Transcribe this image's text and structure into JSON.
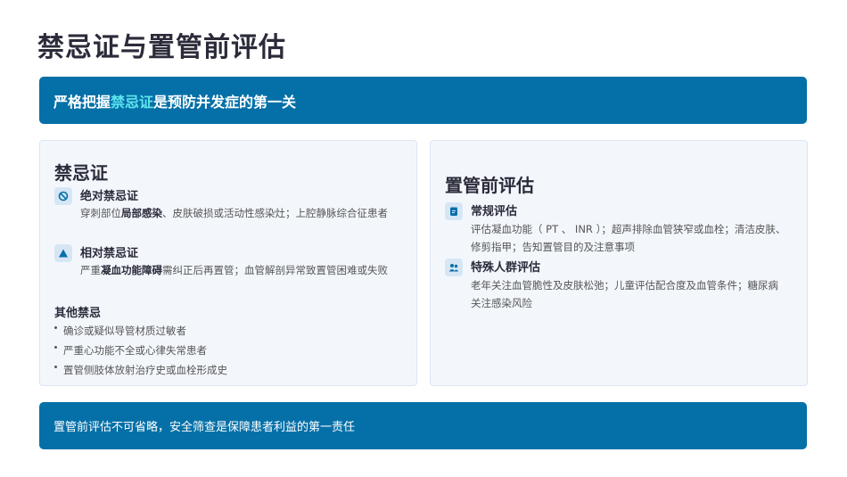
{
  "title": "禁忌证与置管前评估",
  "banner": {
    "prefix": "严格把握",
    "highlight": "禁忌证",
    "suffix": "是预防并发症的第一关"
  },
  "left": {
    "heading": "禁忌证",
    "absolute": {
      "icon": "no-entry-icon",
      "title": "绝对禁忌证",
      "desc_pre": "穿刺部位",
      "desc_bold": "局部感染",
      "desc_post": "、皮肤破损或活动性感染灶；上腔静脉综合征患者"
    },
    "relative": {
      "icon": "warning-triangle-icon",
      "title": "相对禁忌证",
      "desc_pre": "严重",
      "desc_bold": "凝血功能障碍",
      "desc_post": "需纠正后再置管；血管解剖异常致置管困难或失败"
    },
    "other_title": "其他禁忌",
    "other_items": [
      "确诊或疑似导管材质过敏者",
      "严重心功能不全或心律失常患者",
      "置管侧肢体放射治疗史或血栓形成史"
    ]
  },
  "right": {
    "heading": "置管前评估",
    "routine": {
      "icon": "clipboard-icon",
      "title": "常规评估",
      "desc_line1": "评估凝血功能（ PT 、 INR ）；超声排除血管狭窄或血栓；清洁皮肤、",
      "desc_line2": "修剪指甲；告知置管目的及注意事项"
    },
    "special": {
      "icon": "people-icon",
      "title": "特殊人群评估",
      "desc_line1": "老年关注血管脆性及皮肤松弛；儿童评估配合度及血管条件；糖尿病",
      "desc_line2": "关注感染风险"
    }
  },
  "footer": "置管前评估不可省略，安全筛查是保障患者利益的第一责任",
  "colors": {
    "primary": "#0570a8",
    "highlight": "#5ee6ef",
    "card_bg": "#f3f7fc"
  }
}
